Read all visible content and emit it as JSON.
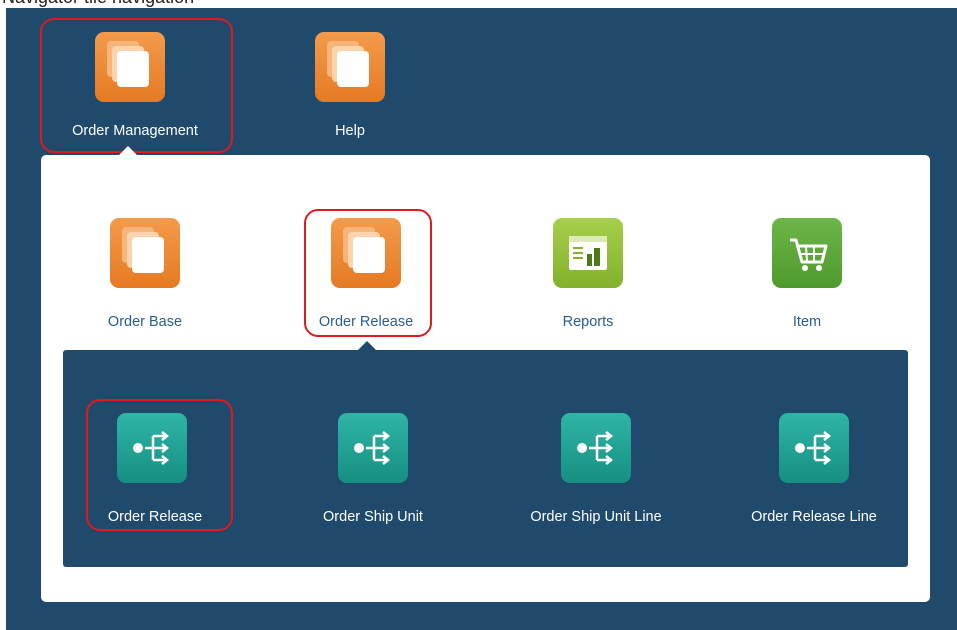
{
  "top_caption": "Navigator tile navigation",
  "top_tiles": [
    {
      "label": "Order Management",
      "icon": "stacked-pages-icon",
      "color": "#e8852d"
    },
    {
      "label": "Help",
      "icon": "stacked-pages-icon",
      "color": "#e8852d"
    }
  ],
  "mid_tiles": [
    {
      "label": "Order Base",
      "icon": "stacked-pages-icon",
      "color": "#e8852d"
    },
    {
      "label": "Order Release",
      "icon": "stacked-pages-icon",
      "color": "#e8852d"
    },
    {
      "label": "Reports",
      "icon": "report-icon",
      "color": "#93c13a"
    },
    {
      "label": "Item",
      "icon": "shopping-cart-icon",
      "color": "#5aa63a"
    }
  ],
  "sub_tiles": [
    {
      "label": "Order Release",
      "icon": "split-flow-icon",
      "color": "#22a294"
    },
    {
      "label": "Order Ship Unit",
      "icon": "split-flow-icon",
      "color": "#22a294"
    },
    {
      "label": "Order Ship Unit Line",
      "icon": "split-flow-icon",
      "color": "#22a294"
    },
    {
      "label": "Order Release Line",
      "icon": "split-flow-icon",
      "color": "#22a294"
    }
  ],
  "colors": {
    "navy": "#1f4a6c",
    "highlight": "#e0191d",
    "link": "#2a5d8f"
  }
}
